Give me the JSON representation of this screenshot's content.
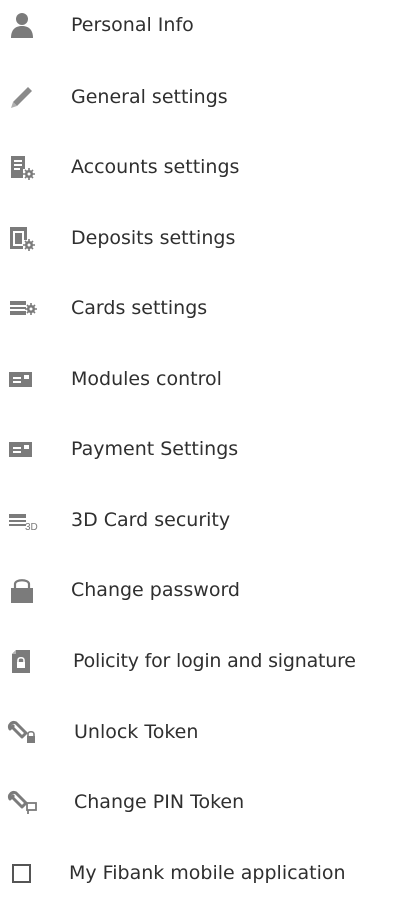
{
  "menu": {
    "items": [
      {
        "label": "Personal Info",
        "icon": "user-icon"
      },
      {
        "label": "General settings",
        "icon": "pencil-icon"
      },
      {
        "label": "Accounts settings",
        "icon": "accounts-settings-icon"
      },
      {
        "label": "Deposits settings",
        "icon": "deposits-settings-icon"
      },
      {
        "label": "Cards settings",
        "icon": "cards-settings-icon"
      },
      {
        "label": "Modules control",
        "icon": "module-card-icon"
      },
      {
        "label": "Payment Settings",
        "icon": "payment-card-icon"
      },
      {
        "label": "3D Card security",
        "icon": "3d-card-icon",
        "icon_text": "3D"
      },
      {
        "label": "Change password",
        "icon": "padlock-icon"
      },
      {
        "label": "Policity for login and signature",
        "icon": "policy-document-icon"
      },
      {
        "label": "Unlock Token",
        "icon": "token-unlock-icon"
      },
      {
        "label": "Change PIN Token",
        "icon": "token-pin-icon"
      },
      {
        "label": "My Fibank mobile application",
        "icon": "mobile-app-checkbox-icon"
      }
    ]
  },
  "colors": {
    "icon": "#7b7b7b",
    "text": "#2f2f2f",
    "background": "#ffffff"
  }
}
